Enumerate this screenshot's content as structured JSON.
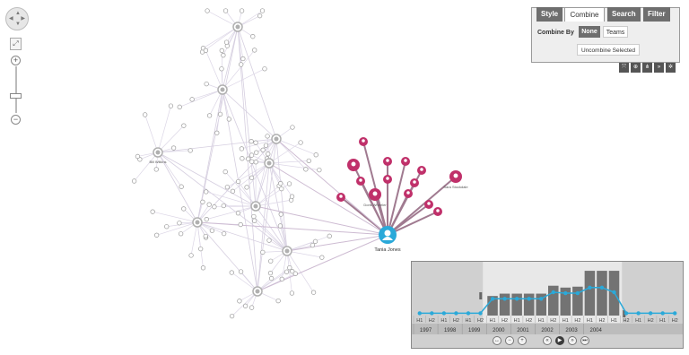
{
  "navigator": {
    "pan_up": "▲",
    "pan_down": "▼",
    "pan_left": "◀",
    "pan_right": "▶",
    "fit": "⤢",
    "zoom_in": "+",
    "zoom_out": "−"
  },
  "panel": {
    "tabs": [
      {
        "label": "Style",
        "active": false
      },
      {
        "label": "Combine",
        "active": true
      },
      {
        "label": "Search",
        "active": false
      },
      {
        "label": "Filter",
        "active": false
      }
    ],
    "combine_by_label": "Combine By",
    "options": [
      "None",
      "Teams"
    ],
    "selected_option": "None",
    "uncombine_button": "Uncombine Selected",
    "toolbar_icons": [
      "fit-icon",
      "zoom-icon",
      "hierarchy-icon",
      "forward-icon",
      "settings-icon"
    ]
  },
  "graph": {
    "focus_label": "Tania Jones",
    "labels": [
      "Bill Wilkins",
      "Sara Stockdale",
      "Doris Wheeler"
    ],
    "colors": {
      "accent": "#c0306a",
      "focus": "#2aa9d9",
      "neutral": "#b0b0b0"
    }
  },
  "timebar": {
    "years": [
      "1997",
      "1998",
      "1999",
      "2000",
      "2001",
      "2002",
      "2003",
      "2004"
    ],
    "halves": [
      "H1",
      "H2"
    ],
    "bar_values": [
      0,
      0,
      0,
      0,
      0,
      0,
      0.42,
      0.47,
      0.47,
      0.47,
      0.47,
      0.64,
      0.6,
      0.62,
      0.96,
      0.96,
      0.96,
      0,
      0,
      0,
      0,
      0
    ],
    "line_values": [
      0.05,
      0.05,
      0.05,
      0.05,
      0.05,
      0.05,
      0.36,
      0.36,
      0.36,
      0.36,
      0.36,
      0.5,
      0.48,
      0.48,
      0.6,
      0.6,
      0.5,
      0.05,
      0.05,
      0.05,
      0.05,
      0.05
    ],
    "selection_start_index": 6,
    "selection_end_index": 17,
    "controls": [
      "zoom-fit-icon",
      "zoom-out-icon",
      "zoom-in-icon",
      "rewind-icon",
      "play-icon",
      "forward-icon",
      "end-icon"
    ],
    "colors": {
      "bar": "#737373",
      "line": "#2aa9d9",
      "bg": "#d0d0d0",
      "selection": "#e8e8e8"
    }
  }
}
